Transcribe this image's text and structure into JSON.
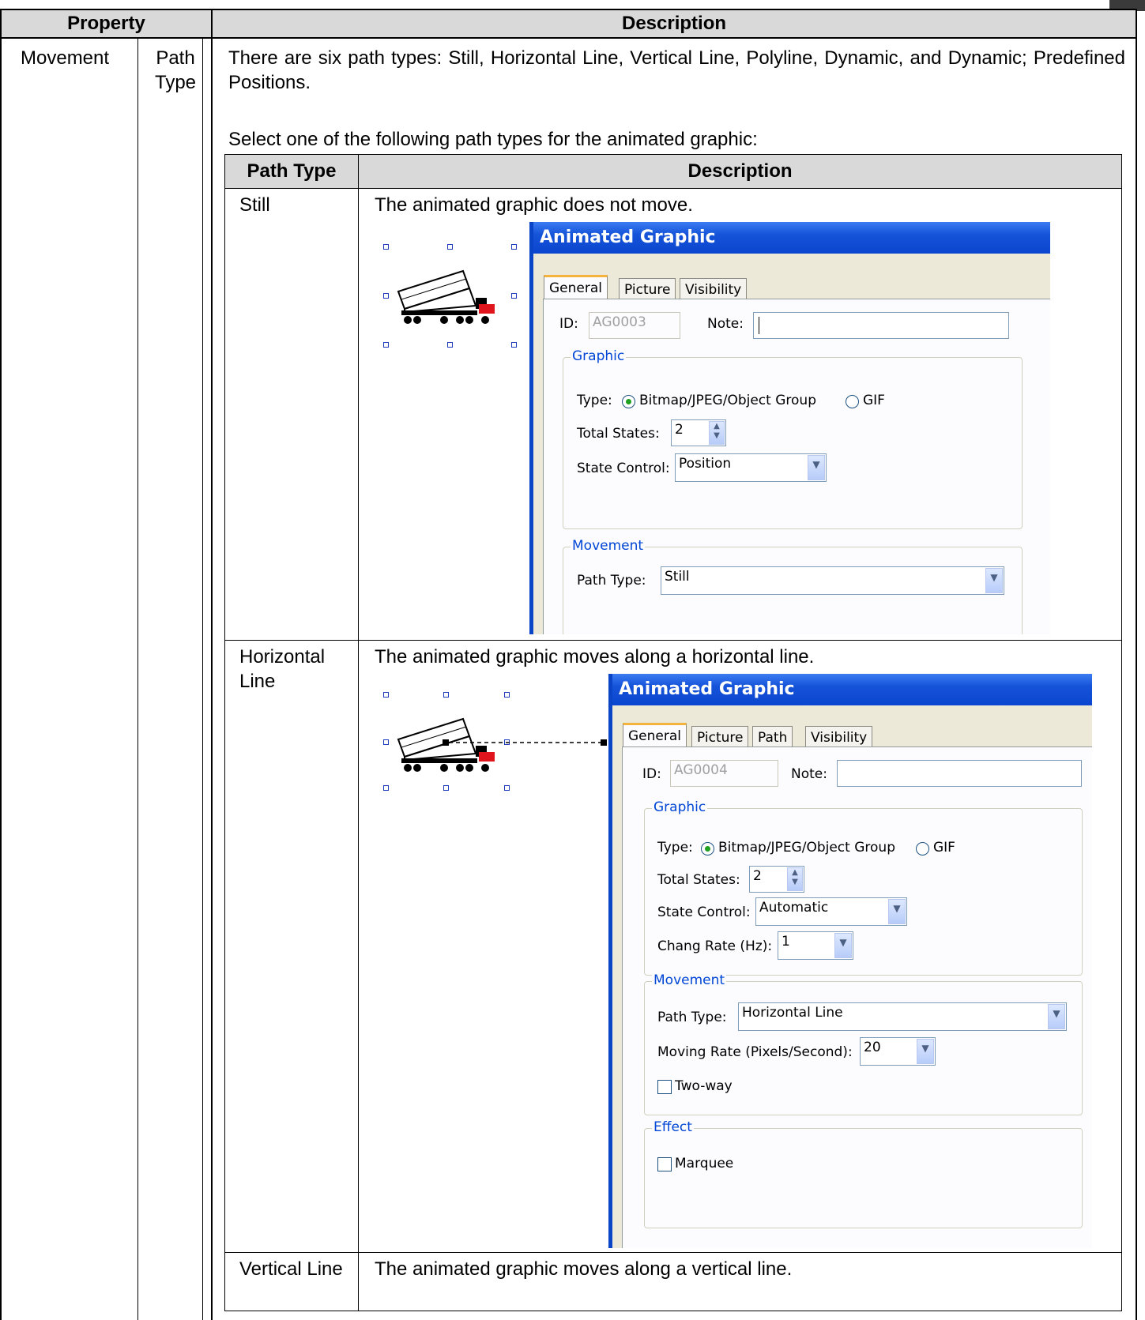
{
  "table": {
    "headers": {
      "property": "Property",
      "description": "Description"
    },
    "property_name": "Movement",
    "sub_property": "Path Type",
    "intro": "There are six path types: Still, Horizontal Line, Vertical Line, Polyline, Dynamic, and Dynamic; Predefined Positions.",
    "select_text": "Select one of the following path types for the animated graphic:",
    "inner_headers": {
      "path_type": "Path Type",
      "description": "Description"
    },
    "rows": [
      {
        "type": "Still",
        "description": "The animated graphic does not move."
      },
      {
        "type": "Horizontal Line",
        "description": "The animated graphic moves along a horizontal line."
      },
      {
        "type": "Vertical Line",
        "description": "The animated graphic moves along a vertical line."
      }
    ]
  },
  "dialog_still": {
    "title": "Animated Graphic",
    "tabs": [
      "General",
      "Picture",
      "Visibility"
    ],
    "id_label": "ID:",
    "id_value": "AG0003",
    "note_label": "Note:",
    "graphic_group": "Graphic",
    "type_label": "Type:",
    "type_option1": "Bitmap/JPEG/Object Group",
    "type_option2": "GIF",
    "total_states_label": "Total States:",
    "total_states_value": "2",
    "state_control_label": "State Control:",
    "state_control_value": "Position",
    "movement_group": "Movement",
    "path_type_label": "Path Type:",
    "path_type_value": "Still"
  },
  "dialog_horizontal": {
    "title": "Animated Graphic",
    "tabs": [
      "General",
      "Picture",
      "Path",
      "Visibility"
    ],
    "id_label": "ID:",
    "id_value": "AG0004",
    "note_label": "Note:",
    "graphic_group": "Graphic",
    "type_label": "Type:",
    "type_option1": "Bitmap/JPEG/Object Group",
    "type_option2": "GIF",
    "total_states_label": "Total States:",
    "total_states_value": "2",
    "state_control_label": "State Control:",
    "state_control_value": "Automatic",
    "change_rate_label": "Chang Rate (Hz):",
    "change_rate_value": "1",
    "movement_group": "Movement",
    "path_type_label": "Path Type:",
    "path_type_value": "Horizontal Line",
    "moving_rate_label": "Moving Rate (Pixels/Second):",
    "moving_rate_value": "20",
    "two_way_label": "Two-way",
    "effect_group": "Effect",
    "marquee_label": "Marquee"
  }
}
